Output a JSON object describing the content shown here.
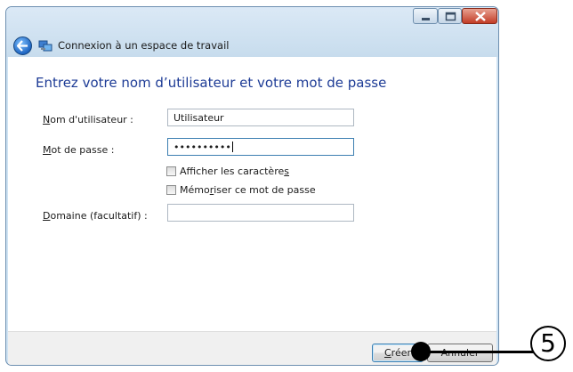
{
  "window": {
    "title": "Connexion à un espace de travail",
    "controls": {
      "minimize_icon": "minimize-icon",
      "maximize_icon": "maximize-icon",
      "close_icon": "close-icon"
    },
    "back_icon": "back-arrow-icon",
    "app_icon": "remote-workspace-icon"
  },
  "form": {
    "heading": "Entrez votre nom d’utilisateur et votre mot de passe",
    "username": {
      "label_first": "N",
      "label_rest": "om d'utilisateur :",
      "value": "Utilisateur"
    },
    "password": {
      "label_first": "M",
      "label_rest": "ot de passe :",
      "value": "••••••••••"
    },
    "show_chars": {
      "label_pre": "Afficher les caractère",
      "label_underlined": "s",
      "checked": false
    },
    "remember": {
      "label_pre": "Mémo",
      "label_underlined": "r",
      "label_post": "iser ce mot de passe",
      "checked": false
    },
    "domain": {
      "label_first": "D",
      "label_rest": "omaine (facultatif) :",
      "value": ""
    }
  },
  "footer": {
    "create_first": "C",
    "create_rest": "réer",
    "cancel_label": "Annuler"
  },
  "annotation": {
    "number": "5"
  },
  "colors": {
    "heading": "#1e3c96",
    "window_frame": "#cfe3f3",
    "footer": "#f0f0f0"
  }
}
